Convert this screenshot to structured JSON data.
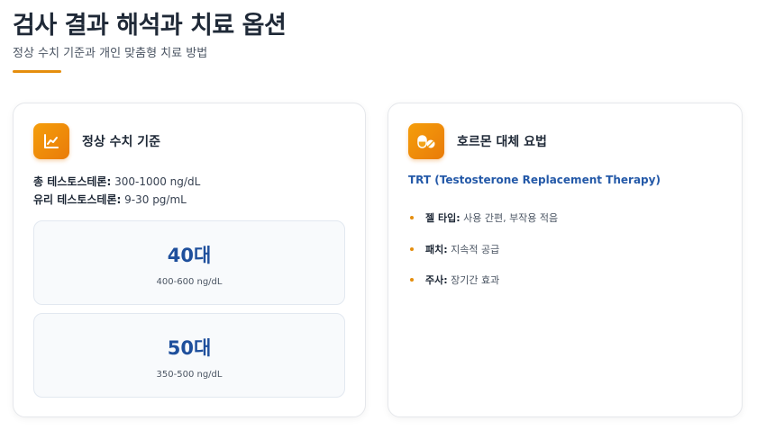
{
  "header": {
    "title": "검사 결과 해석과 치료 옵션",
    "subtitle": "정상 수치 기준과 개인 맞춤형 치료 방법"
  },
  "normal_card": {
    "icon": "chart-line-icon",
    "title": "정상 수치 기준",
    "total_label": "총 테스토스테론:",
    "total_value": "300-1000 ng/dL",
    "free_label": "유리 테스토스테론:",
    "free_value": "9-30 pg/mL",
    "age_groups": [
      {
        "age": "40대",
        "range": "400-600 ng/dL"
      },
      {
        "age": "50대",
        "range": "350-500 ng/dL"
      }
    ]
  },
  "therapy_card": {
    "icon": "pills-icon",
    "title": "호르몬 대체 요법",
    "subtitle": "TRT (Testosterone Replacement Therapy)",
    "options": [
      {
        "label": "젤 타입:",
        "desc": "사용 간편, 부작용 적음"
      },
      {
        "label": "패치:",
        "desc": "지속적 공급"
      },
      {
        "label": "주사:",
        "desc": "장기간 효과"
      }
    ]
  },
  "colors": {
    "accent": "#e58e0e",
    "heading_blue": "#1e4f9c",
    "link_blue": "#2459a8"
  }
}
